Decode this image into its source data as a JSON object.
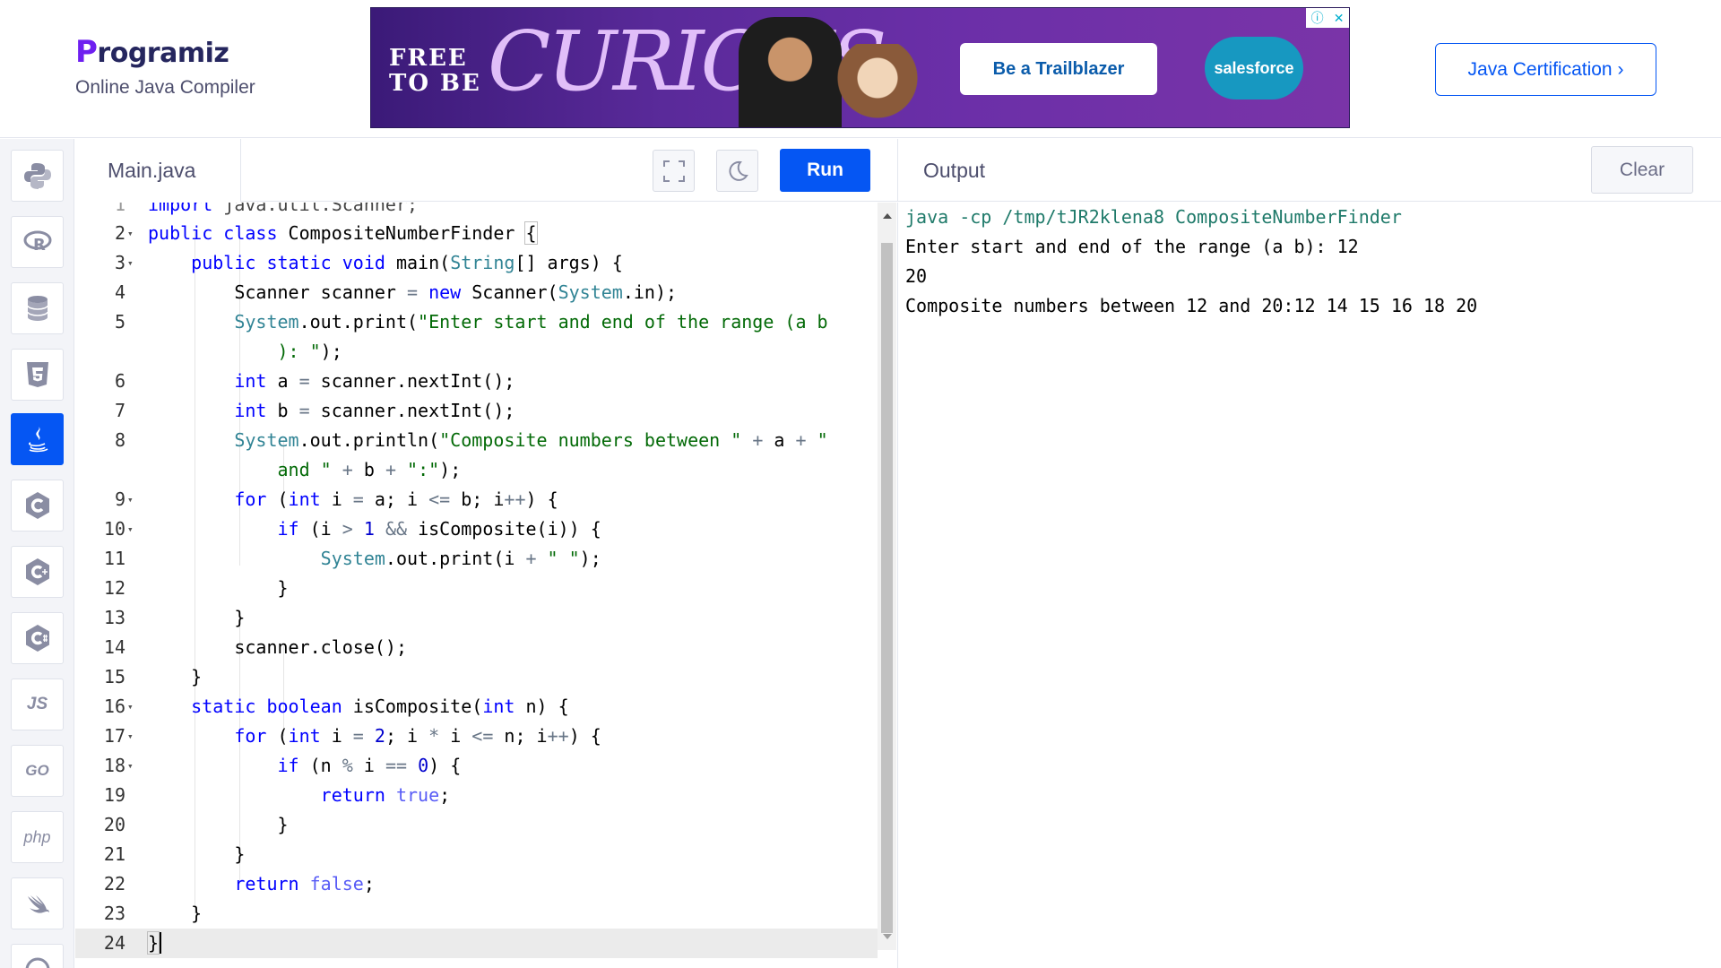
{
  "header": {
    "logo": "Programiz",
    "logo_rest": "rogramiz",
    "logo_p": "P",
    "subtitle": "Online Java Compiler",
    "cert_button": "Java Certification ›"
  },
  "ad": {
    "free_line1": "FREE",
    "free_line2": "TO BE",
    "headline": "CURIOUS",
    "cta": "Be a Trailblazer",
    "brand": "salesforce"
  },
  "sidebar": {
    "items": [
      {
        "name": "python",
        "icon": "python-icon"
      },
      {
        "name": "r",
        "icon": "r-icon"
      },
      {
        "name": "sql",
        "icon": "database-icon"
      },
      {
        "name": "html",
        "icon": "html5-icon"
      },
      {
        "name": "java",
        "icon": "java-icon",
        "active": true
      },
      {
        "name": "c",
        "icon": "c-icon"
      },
      {
        "name": "cpp",
        "icon": "cpp-icon"
      },
      {
        "name": "csharp",
        "icon": "csharp-icon"
      },
      {
        "name": "js",
        "icon": "js-icon",
        "label": "JS"
      },
      {
        "name": "go",
        "icon": "go-icon",
        "label": "GO"
      },
      {
        "name": "php",
        "icon": "php-icon",
        "label": "php"
      },
      {
        "name": "swift",
        "icon": "swift-icon"
      },
      {
        "name": "rust",
        "icon": "rust-icon"
      }
    ]
  },
  "editor": {
    "tab": "Main.java",
    "run_label": "Run",
    "partial_first_line": "import java.util.Scanner;",
    "lines": [
      {
        "n": "2",
        "fold": true
      },
      {
        "n": "3",
        "fold": true
      },
      {
        "n": "4"
      },
      {
        "n": "5"
      },
      {
        "n": ""
      },
      {
        "n": "6"
      },
      {
        "n": "7"
      },
      {
        "n": "8"
      },
      {
        "n": ""
      },
      {
        "n": "9",
        "fold": true
      },
      {
        "n": "10",
        "fold": true
      },
      {
        "n": "11"
      },
      {
        "n": "12"
      },
      {
        "n": "13"
      },
      {
        "n": "14"
      },
      {
        "n": "15"
      },
      {
        "n": "16",
        "fold": true
      },
      {
        "n": "17",
        "fold": true
      },
      {
        "n": "18",
        "fold": true
      },
      {
        "n": "19"
      },
      {
        "n": "20"
      },
      {
        "n": "21"
      },
      {
        "n": "22"
      },
      {
        "n": "23"
      },
      {
        "n": "24"
      }
    ]
  },
  "output": {
    "title": "Output",
    "clear_label": "Clear",
    "lines": [
      "java -cp /tmp/tJR2klena8 CompositeNumberFinder",
      "Enter start and end of the range (a b): 12",
      "20",
      "Composite numbers between 12 and 20:12 14 15 16 18 20"
    ]
  },
  "colors": {
    "accent": "#0556f3",
    "brand_purple": "#6e1ff0",
    "ad_bg": "#5a2a9a"
  }
}
